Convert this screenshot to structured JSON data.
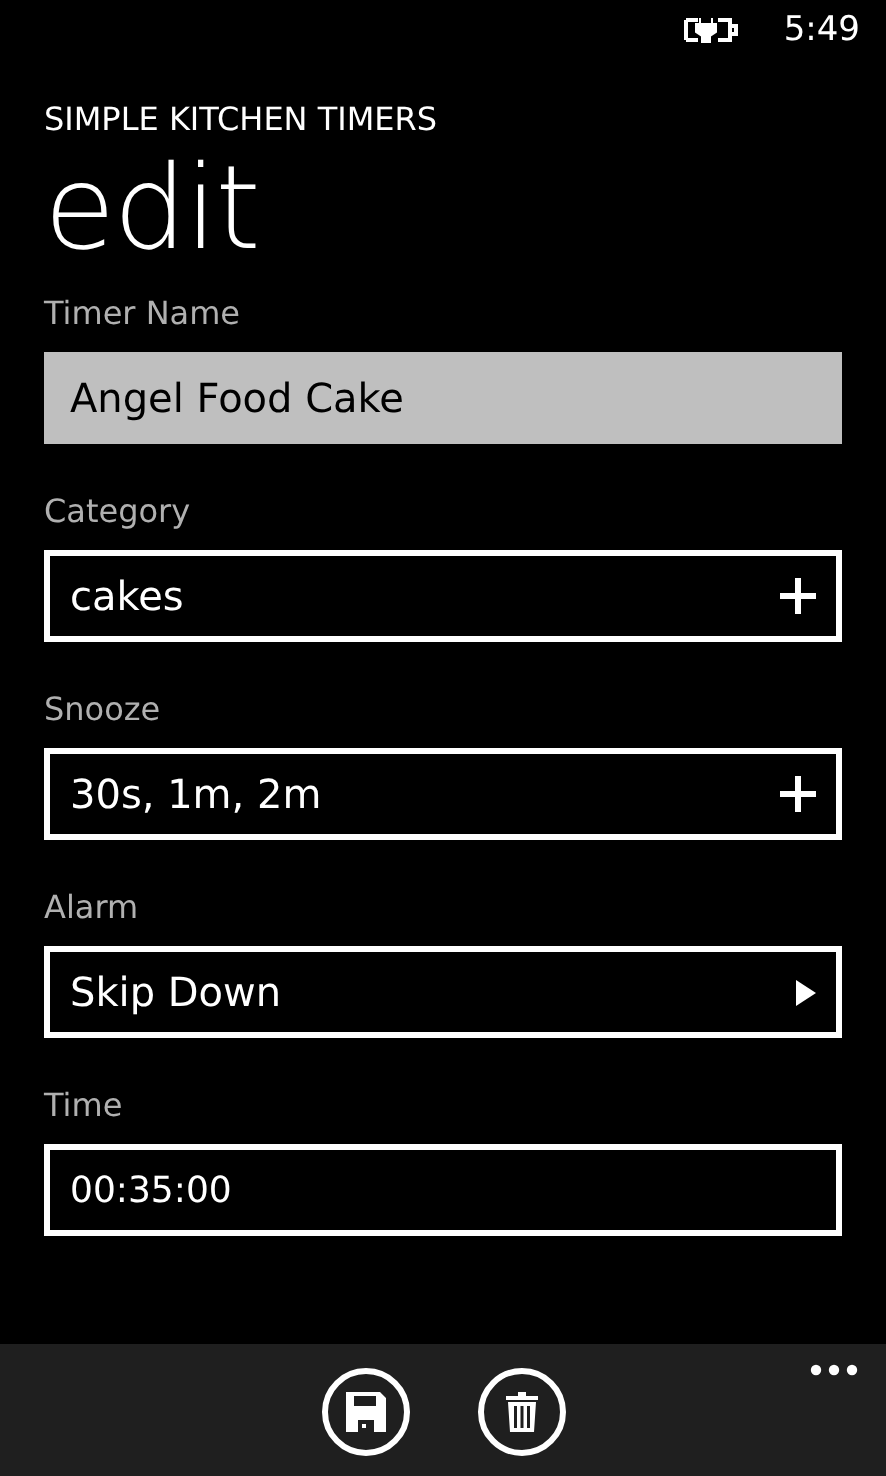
{
  "status_bar": {
    "time": "5:49"
  },
  "app_title": "SIMPLE KITCHEN TIMERS",
  "page_title": "edit",
  "fields": [
    {
      "label": "Timer Name",
      "kind": "textbox",
      "value": "Angel Food Cake",
      "focused": true
    },
    {
      "label": "Category",
      "kind": "add-picker",
      "value": "cakes"
    },
    {
      "label": "Snooze",
      "kind": "add-picker",
      "value": "30s, 1m, 2m"
    },
    {
      "label": "Alarm",
      "kind": "dropdown",
      "value": "Skip Down"
    },
    {
      "label": "Time",
      "kind": "textbox",
      "value": "00:35:00",
      "focused": false
    }
  ],
  "app_bar": {
    "buttons": [
      {
        "kind": "save"
      },
      {
        "kind": "delete"
      }
    ]
  }
}
